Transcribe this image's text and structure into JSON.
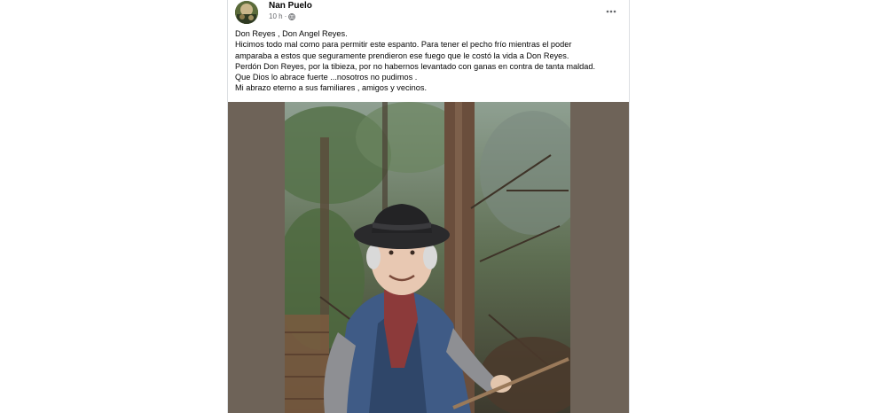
{
  "post": {
    "author": "Nan Puelo",
    "time": "10 h",
    "separator": "·",
    "privacy_icon": "globe-icon",
    "more_icon": "more-options-icon",
    "lines": [
      "Don Reyes , Don Angel Reyes.",
      "Hicimos todo mal como para permitir este espanto. Para tener el pecho frío mientras el poder",
      "amparaba a estos que seguramente prendieron ese fuego que le costó la vida a Don Reyes.",
      "Perdón Don Reyes, por la tibieza, por no habernos levantado con ganas en contra de tanta maldad.",
      "Que Dios lo abrace fuerte ...nosotros no pudimos .",
      "Mi abrazo eterno a sus familiares , amigos y vecinos."
    ]
  },
  "colors": {
    "photo_background": "#6e6358",
    "text": "#050505",
    "meta": "#65676b"
  }
}
